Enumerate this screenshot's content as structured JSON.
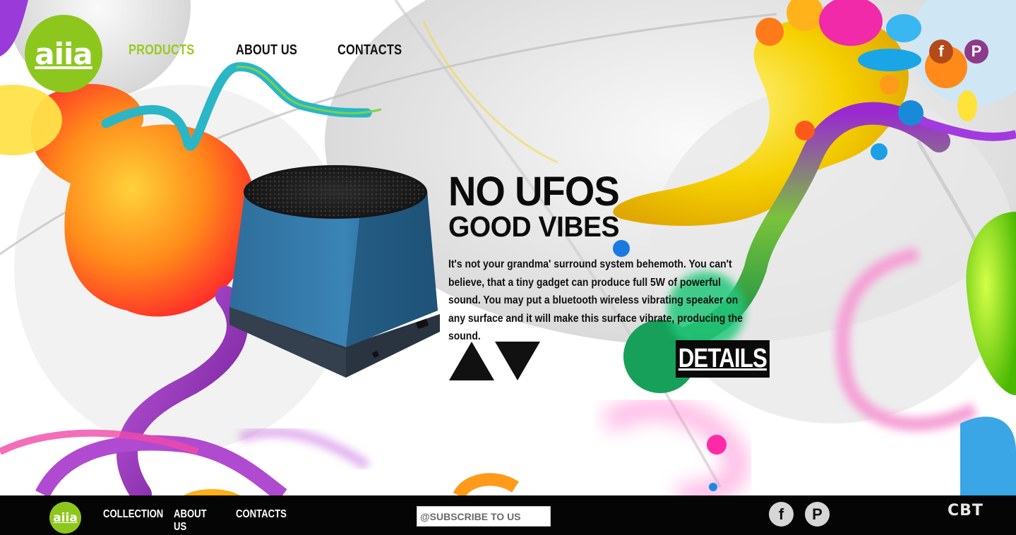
{
  "brand": {
    "logo_text": "aiia",
    "accent_color": "#8dc71e"
  },
  "nav": {
    "items": [
      {
        "label": "PRODUCTS",
        "active": true
      },
      {
        "label": "ABOUT US",
        "active": false
      },
      {
        "label": "CONTACTS",
        "active": false
      }
    ]
  },
  "social_top": {
    "facebook": "f",
    "pinterest": "P"
  },
  "hero": {
    "headline": "NO UFOS",
    "subheadline": "GOOD VIBES",
    "description": "It's not your grandma' surround system behemoth. You can't believe, that a tiny gadget can produce full 5W of powerful sound. You may put a bluetooth wireless vibrating speaker on any surface and it will make this surface vibrate, producing the sound.",
    "details_label": "DETAILS",
    "prev_icon": "triangle-up-icon",
    "next_icon": "triangle-down-icon"
  },
  "footer": {
    "logo_text": "aiia",
    "nav": [
      "COLLECTION",
      "ABOUT US",
      "CONTACTS"
    ],
    "subscribe_placeholder": "@SUBSCRIBE TO US",
    "social": {
      "facebook": "f",
      "pinterest": "P"
    },
    "credit": "CBT"
  }
}
